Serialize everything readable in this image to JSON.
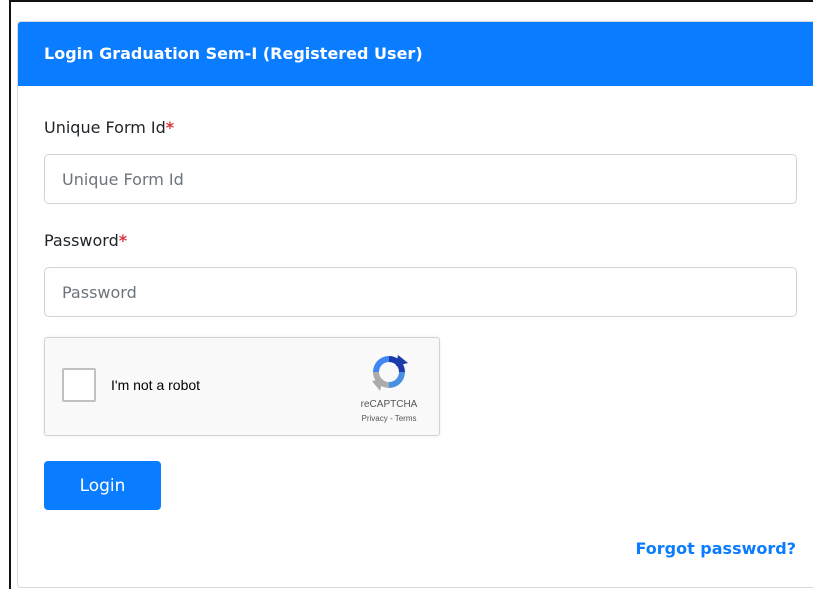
{
  "card": {
    "title": "Login Graduation Sem-I (Registered User)"
  },
  "form": {
    "form_id": {
      "label": "Unique Form Id",
      "required_mark": "*",
      "placeholder": "Unique Form Id",
      "value": ""
    },
    "password": {
      "label": "Password",
      "required_mark": "*",
      "placeholder": "Password",
      "value": ""
    }
  },
  "captcha": {
    "label": "I'm not a robot",
    "brand": "reCAPTCHA",
    "privacy": "Privacy",
    "separator": " - ",
    "terms": "Terms",
    "checked": false,
    "icon": "recaptcha-logo-icon"
  },
  "actions": {
    "login_label": "Login",
    "forgot_label": "Forgot password?"
  },
  "colors": {
    "primary": "#0a7cff",
    "required": "#dc3545",
    "input_border": "#ced4da"
  }
}
